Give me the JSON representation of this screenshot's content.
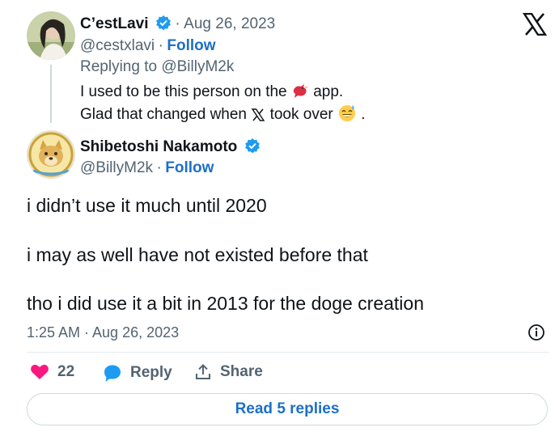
{
  "quoted": {
    "author_name": "C’estLavi",
    "date": "Aug 26, 2023",
    "handle": "@cestxlavi",
    "follow_label": "Follow",
    "replying_to": "Replying to @BillyM2k",
    "line1_before": "I used to be this person on the",
    "line1_after": "app.",
    "line2_before": "Glad that changed when",
    "line2_after": "took over",
    "line2_end": "."
  },
  "post": {
    "author_name": "Shibetoshi Nakamoto",
    "handle": "@BillyM2k",
    "follow_label": "Follow",
    "paragraphs": [
      "i didn’t use it much until 2020",
      "i may as well have not existed before that",
      "tho i did use it a bit in 2013 for the doge creation"
    ],
    "timestamp": "1:25 AM · Aug 26, 2023"
  },
  "actions": {
    "likes_count": "22",
    "reply_label": "Reply",
    "share_label": "Share"
  },
  "read_replies_label": "Read 5 replies",
  "separator": "·",
  "colors": {
    "accent": "#1d6fc7",
    "verified": "#1d9bf0",
    "like": "#f91880",
    "muted": "#536471"
  },
  "icons": [
    "x-logo-icon",
    "verified-badge-icon",
    "bird-icon",
    "x-letter-icon",
    "sweat-smile-emoji-icon",
    "heart-icon",
    "speech-bubble-icon",
    "share-arrow-icon",
    "info-icon"
  ]
}
